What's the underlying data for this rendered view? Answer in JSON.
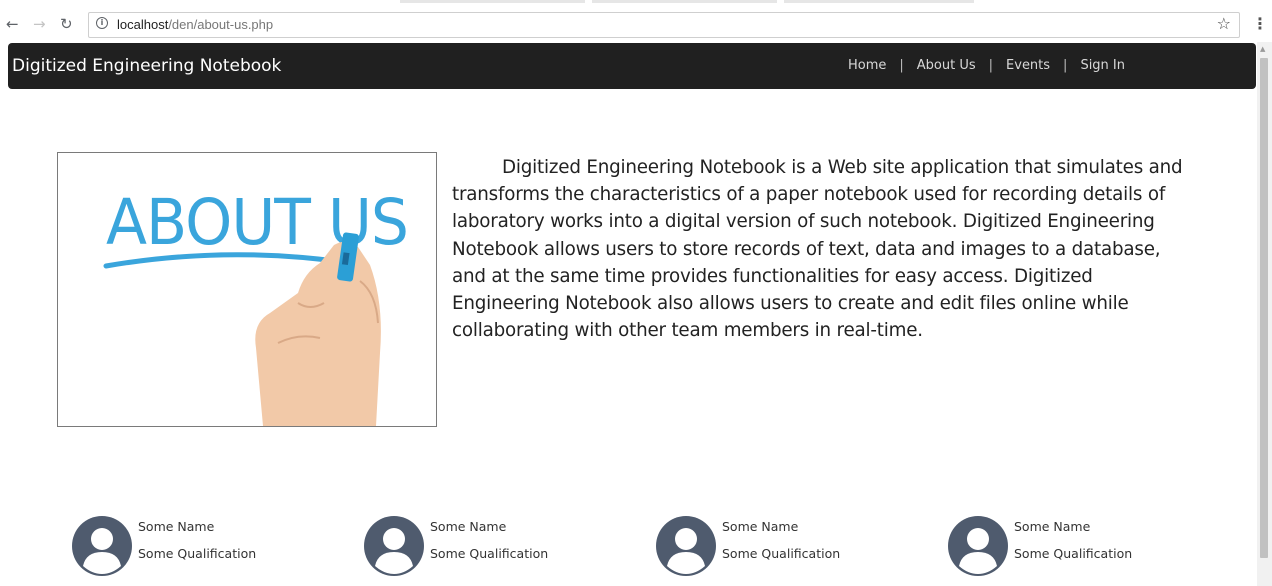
{
  "browser": {
    "url_host": "localhost",
    "url_path": "/den/about-us.php",
    "back_icon": "arrow-left-icon",
    "forward_icon": "arrow-right-icon",
    "reload_icon": "reload-icon",
    "star_icon": "star-icon",
    "menu_icon": "kebab-menu-icon"
  },
  "site": {
    "brand": "Digitized Engineering Notebook",
    "nav": [
      {
        "label": "Home"
      },
      {
        "label": "About Us"
      },
      {
        "label": "Events"
      },
      {
        "label": "Sign In"
      }
    ],
    "nav_separator": "|"
  },
  "about": {
    "image_text": "ABOUT US",
    "description": "Digitized Engineering Notebook is a Web site application that simulates and transforms the characteristics of a paper notebook used for recording details of laboratory works into a digital version of such notebook. Digitized Engineering Notebook allows users to store records of text, data and images to a database, and at the same time provides functionalities for easy access. Digitized Engineering Notebook also allows users to create and edit files online while collaborating with other team members in real-time."
  },
  "team": [
    {
      "name": "Some Name",
      "qualification": "Some Qualification"
    },
    {
      "name": "Some Name",
      "qualification": "Some Qualification"
    },
    {
      "name": "Some Name",
      "qualification": "Some Qualification"
    },
    {
      "name": "Some Name",
      "qualification": "Some Qualification"
    }
  ],
  "colors": {
    "navbar": "#202020",
    "accent_blue": "#3aa5dc",
    "avatar": "#4f5b6e"
  }
}
